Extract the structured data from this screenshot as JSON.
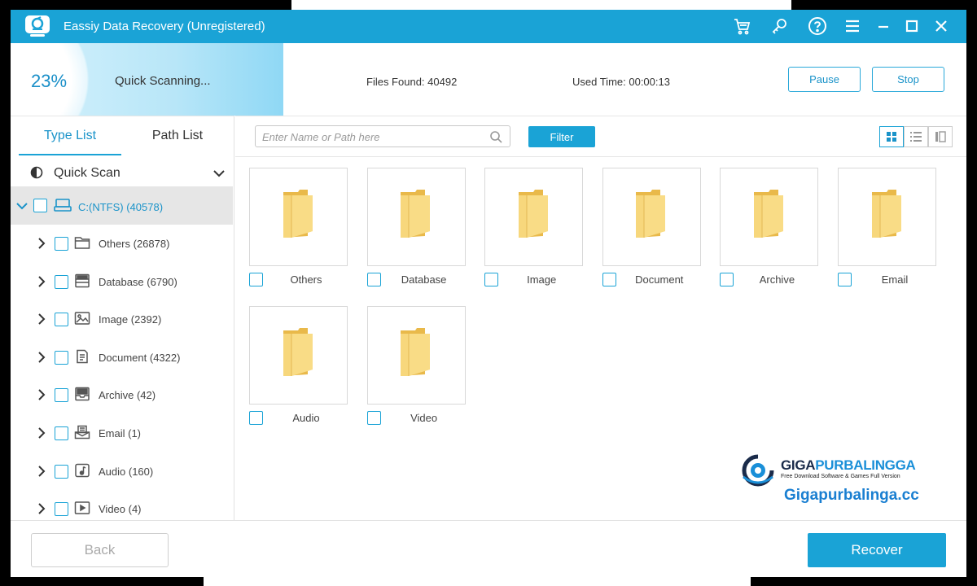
{
  "window": {
    "title": "Eassiy Data Recovery (Unregistered)",
    "title_icons": [
      "cart-icon",
      "key-icon",
      "help-icon",
      "menu-icon",
      "minimize-icon",
      "maximize-icon",
      "close-icon"
    ]
  },
  "scan": {
    "progress_text": "23%",
    "progress_fraction": 0.23,
    "status": "Quick Scanning...",
    "files_found": "Files Found: 40492",
    "used_time": "Used Time: 00:00:13",
    "pause_label": "Pause",
    "stop_label": "Stop"
  },
  "sidebar": {
    "tabs": [
      {
        "label": "Type List",
        "active": true
      },
      {
        "label": "Path List",
        "active": false
      }
    ],
    "scan_mode": "Quick Scan",
    "drive": {
      "label": "C:(NTFS) (40578)",
      "icon": "drive-icon"
    },
    "items": [
      {
        "label": "Others (26878)",
        "icon": "folder-icon"
      },
      {
        "label": "Database (6790)",
        "icon": "database-icon"
      },
      {
        "label": "Image (2392)",
        "icon": "image-icon"
      },
      {
        "label": "Document (4322)",
        "icon": "document-icon"
      },
      {
        "label": "Archive (42)",
        "icon": "archive-icon"
      },
      {
        "label": "Email (1)",
        "icon": "email-icon"
      },
      {
        "label": "Audio (160)",
        "icon": "audio-icon"
      },
      {
        "label": "Video (4)",
        "icon": "video-icon"
      }
    ]
  },
  "toolbar": {
    "search_placeholder": "Enter Name or Path here",
    "filter_label": "Filter",
    "views": [
      "grid-view-icon",
      "list-view-icon",
      "detail-view-icon"
    ],
    "active_view": "grid-view-icon"
  },
  "tiles": [
    {
      "label": "Others"
    },
    {
      "label": "Database"
    },
    {
      "label": "Image"
    },
    {
      "label": "Document"
    },
    {
      "label": "Archive"
    },
    {
      "label": "Email"
    },
    {
      "label": "Audio"
    },
    {
      "label": "Video"
    }
  ],
  "watermark": {
    "brand_left": "GIGA",
    "brand_right": "PURBALINGGA",
    "tagline": "Free Download Software & Games Full Version",
    "url": "Gigapurbalinga.cc"
  },
  "footer": {
    "back_label": "Back",
    "recover_label": "Recover"
  },
  "colors": {
    "accent": "#1aa3d6",
    "folder": "#f5cf6e",
    "selected_row": "#e6e6e6"
  }
}
